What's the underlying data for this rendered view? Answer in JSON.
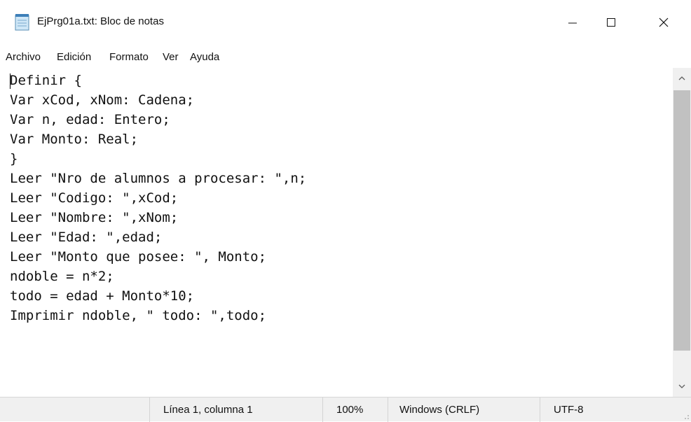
{
  "window": {
    "title": "EjPrg01a.txt: Bloc de notas",
    "app_icon": "notepad-icon",
    "controls": [
      "minimize-icon",
      "maximize-icon",
      "close-icon"
    ]
  },
  "menu": {
    "items": [
      "Archivo",
      "Edición",
      "Formato",
      "Ver",
      "Ayuda"
    ]
  },
  "editor": {
    "lines": [
      "Definir {",
      "Var xCod, xNom: Cadena;",
      "Var n, edad: Entero;",
      "Var Monto: Real;",
      "}",
      "Leer \"Nro de alumnos a procesar: \",n;",
      "Leer \"Codigo: \",xCod;",
      "Leer \"Nombre: \",xNom;",
      "Leer \"Edad: \",edad;",
      "Leer \"Monto que posee: \", Monto;",
      "ndoble = n*2;",
      "todo = edad + Monto*10;",
      "Imprimir ndoble, \" todo: \",todo;"
    ]
  },
  "statusbar": {
    "position": "Línea 1, columna 1",
    "zoom": "100%",
    "line_ending": "Windows (CRLF)",
    "encoding": "UTF-8"
  }
}
